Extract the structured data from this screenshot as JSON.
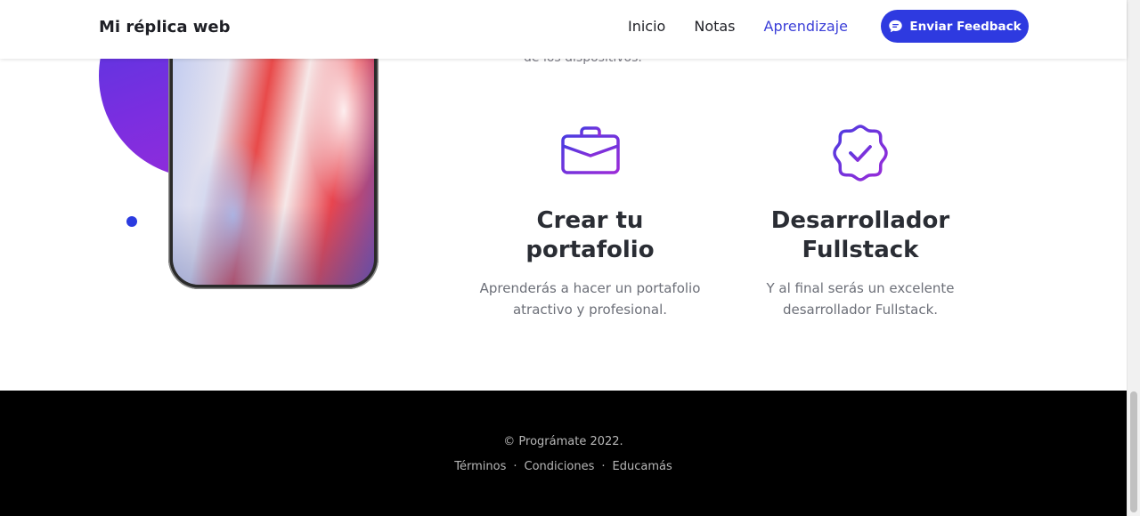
{
  "header": {
    "brand": "Mi réplica web",
    "nav": [
      {
        "label": "Inicio",
        "active": false
      },
      {
        "label": "Notas",
        "active": false
      },
      {
        "label": "Aprendizaje",
        "active": true
      }
    ],
    "feedback_button": {
      "label": "Enviar Feedback",
      "icon": "chat-bubble-icon"
    }
  },
  "main": {
    "partial_text": "de los dispositivos.",
    "features": [
      {
        "icon": "briefcase-icon",
        "title": "Crear tu portafolio",
        "description": "Aprenderás a hacer un portafolio atractivo y profesional."
      },
      {
        "icon": "badge-check-icon",
        "title": "Desarrollador Fullstack",
        "description": "Y al final serás un excelente desarrollador Fullstack."
      }
    ]
  },
  "footer": {
    "copyright": "© Prográmate 2022.",
    "links": [
      "Términos",
      "Condiciones",
      "Educamás"
    ],
    "separator": "·"
  },
  "colors": {
    "accent": "#2e3ae0",
    "nav_active": "#3b3fd8",
    "icon_gradient": [
      "#4b3be0",
      "#9b2bd8"
    ],
    "footer_bg": "#000000"
  }
}
